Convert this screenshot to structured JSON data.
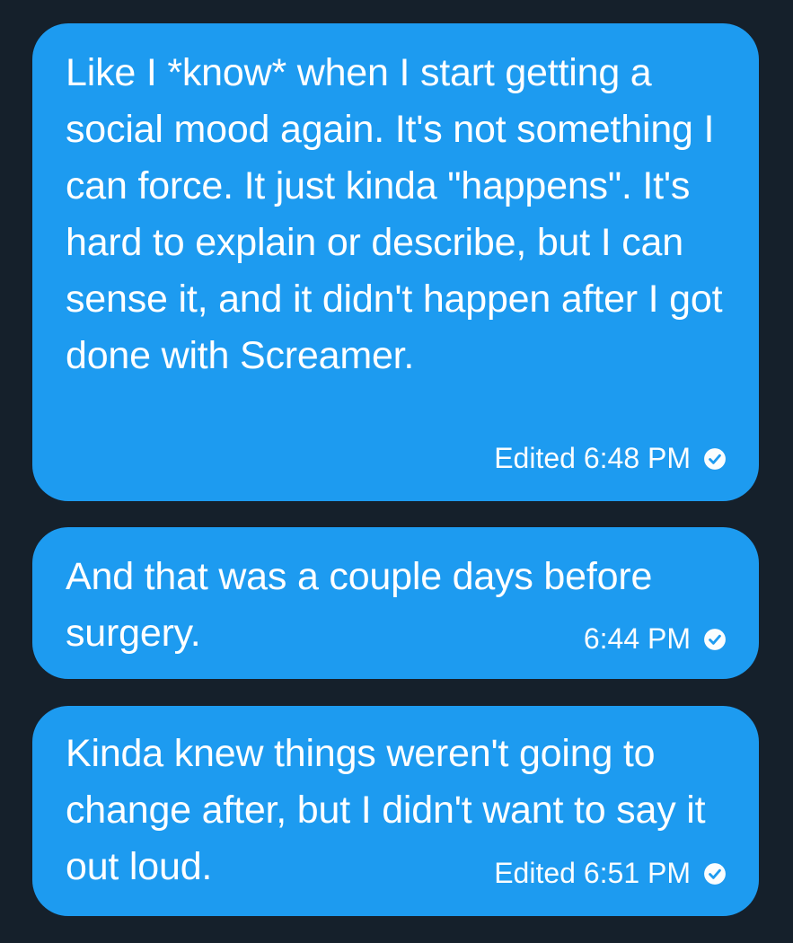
{
  "messages": [
    {
      "text": "Like I *know* when I start getting a social mood again.  It's not something I can force.  It just kinda \"happens\".  It's hard to explain or describe, but I can sense it, and it didn't happen after I got done with Screamer.",
      "status": "Edited 6:48 PM",
      "status_icon": "check-circle-icon"
    },
    {
      "text": "And that was a couple days before surgery.",
      "status": "6:44 PM",
      "status_icon": "check-circle-icon"
    },
    {
      "text": "Kinda knew things weren't going to change after, but I didn't want to say it out loud.",
      "status": "Edited 6:51 PM",
      "status_icon": "check-circle-icon"
    }
  ],
  "colors": {
    "background": "#15202b",
    "bubble": "#1d9bf0",
    "text": "#ffffff"
  }
}
